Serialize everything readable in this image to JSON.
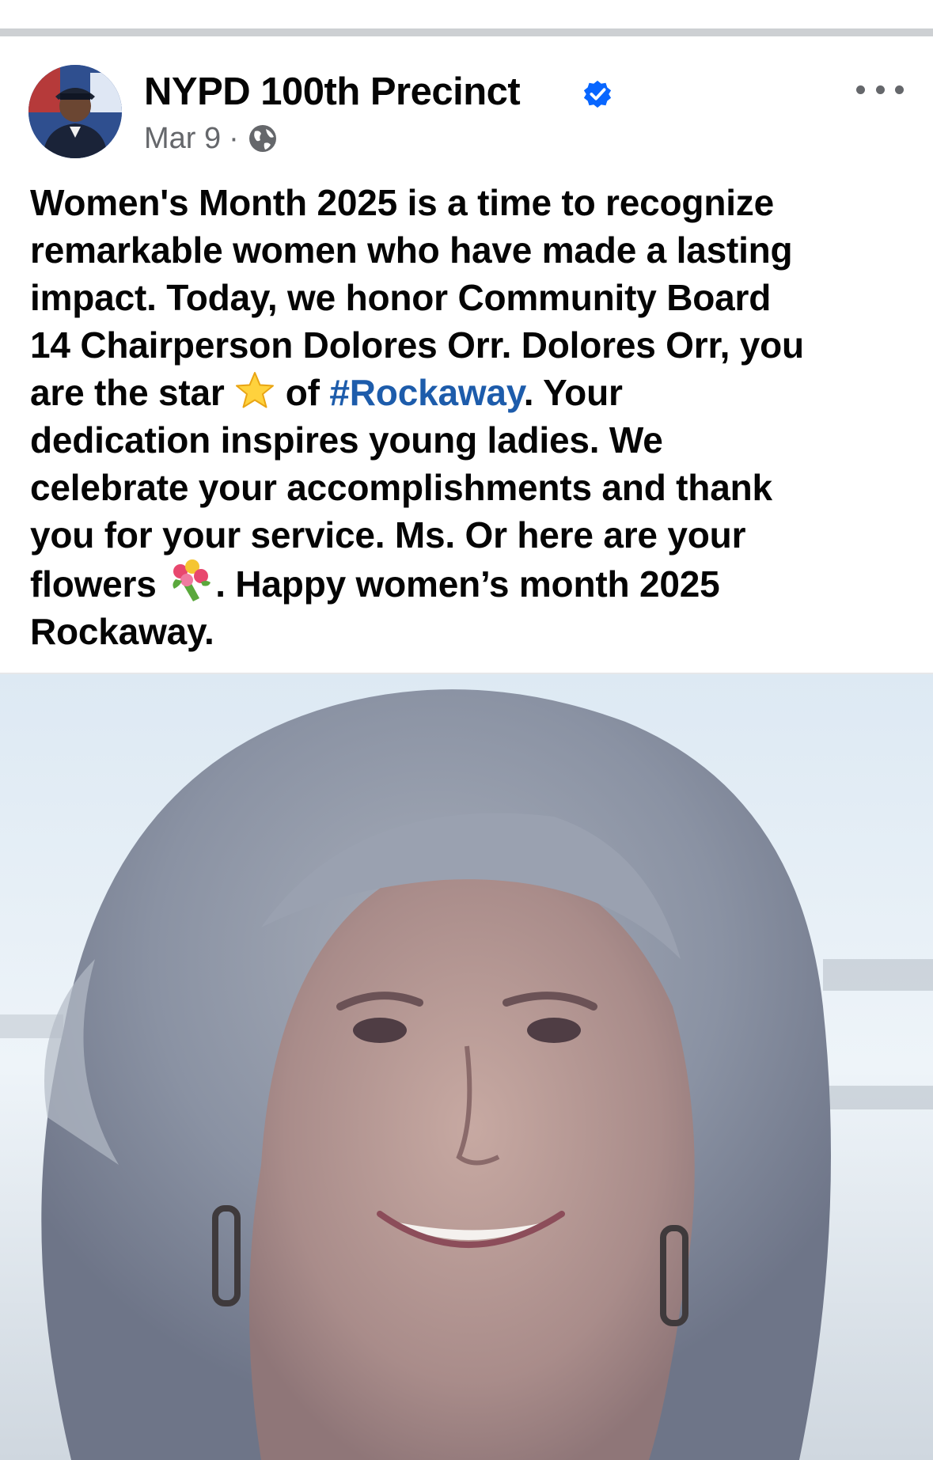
{
  "post": {
    "page_name": "NYPD 100th Precinct",
    "date": "Mar 9",
    "separator": "·",
    "privacy_icon": "globe-icon",
    "verified_icon": "verified-badge-icon",
    "more_icon": "more-options-icon",
    "text_lines": {
      "l1": "Women's Month 2025 is a time to recognize",
      "l2": "remarkable women who have made a lasting",
      "l3": "impact. Today, we honor Community Board",
      "l4": "14 Chairperson Dolores Orr. Dolores Orr, you",
      "l5a": "are the star ",
      "l5b": " of ",
      "hashtag": "#Rockaway",
      "l5c": ". Your",
      "l6": "dedication inspires young ladies. We",
      "l7": "celebrate your accomplishments and thank",
      "l8": "you for your service. Ms. Or here are your",
      "l9a": "flowers ",
      "l9b": ". Happy women’s month 2025",
      "l10": "Rockaway."
    },
    "emojis": {
      "star": "star-emoji-icon",
      "flowers": "bouquet-emoji-icon"
    },
    "colors": {
      "verified": "#0866ff",
      "hashtag": "#1d5cab",
      "meta": "#65676b"
    }
  }
}
